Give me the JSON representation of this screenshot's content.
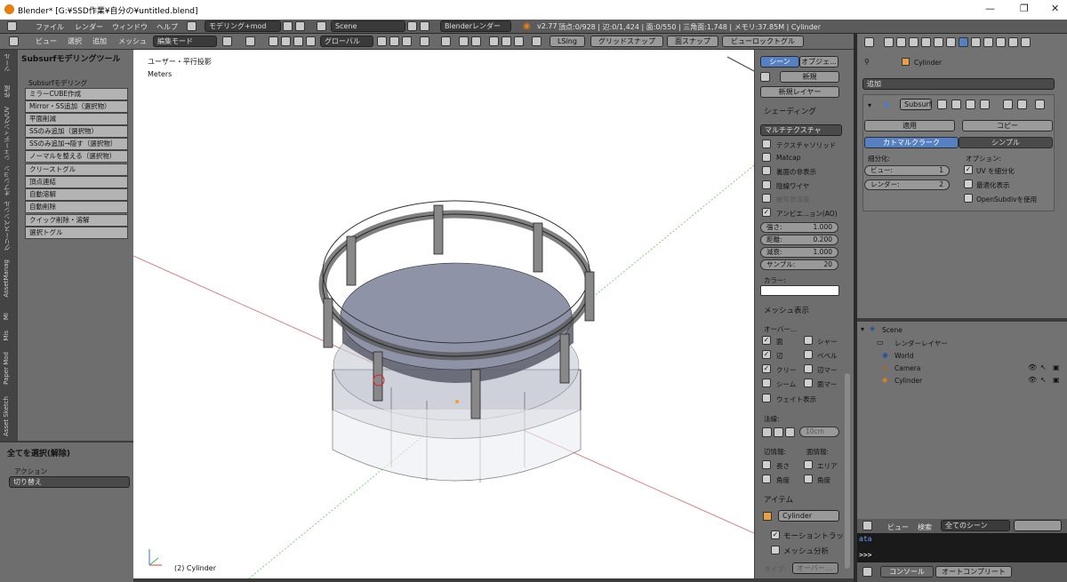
{
  "window": {
    "title": "Blender* [G:¥SSD作業¥自分の¥untitled.blend]",
    "controls": [
      "—",
      "❐",
      "✕"
    ]
  },
  "topbar": {
    "menus": [
      "ファイル",
      "レンダー",
      "ウィンドウ",
      "ヘルプ"
    ],
    "layout": "モデリング+mod",
    "scene": "Scene",
    "engine": "Blenderレンダー",
    "version": "v2.77",
    "stats": "頂点:0/928 | 辺:0/1,424 | 面:0/550 | 三角面:1,748 | メモリ:37.85M | Cylinder"
  },
  "viewheader": {
    "menus": [
      "ビュー",
      "選択",
      "追加",
      "メッシュ"
    ],
    "mode": "編集モード",
    "orientation": "グローバル",
    "lsing": "LSing",
    "grid_snap": "グリッドスナップ",
    "face_snap": "面スナップ",
    "viewlock": "ビューロックトグル"
  },
  "tabs": [
    "ツール",
    "作成",
    "シェーディング/UV",
    "オプション",
    "グリースペンシル",
    "AssetManag",
    "MI",
    "Mis",
    "Paper Mod",
    "Asset Sketch"
  ],
  "tool": {
    "panel_title": "Subsurfモデリングツール",
    "section": "Subsurfモデリング",
    "buttons": [
      "ミラーCUBE作成",
      "Mirror・SS追加（選択物）",
      "平面削減",
      "SSのみ追加（選択物）",
      "SSのみ追加→隠す（選択物）",
      "ノーマルを整える（選択物）",
      "クリーストグル",
      "頂点連結",
      "自動溶解",
      "自動削除",
      "クイック削除・溶解",
      "選択トグル"
    ],
    "op_title": "全てを選択(解除)",
    "action_label": "アクション",
    "action_value": "切り替え"
  },
  "viewport": {
    "view_name": "ユーザー・平行投影",
    "units": "Meters",
    "object_label": "(2) Cylinder"
  },
  "props": {
    "tab_scene": "シーン",
    "tab_object": "オブジェ...",
    "new": "新規",
    "new_layer": "新規レイヤー",
    "shading": "シェーディング",
    "shading_mode": "マルチテクスチャ",
    "shading_opts": [
      "テクスチャソリッド",
      "Matcap",
      "裏面の非表示",
      "陰線ワイヤ",
      "被写界深度",
      "アンビエ...ョン(AO)"
    ],
    "ao": [
      {
        "l": "強さ:",
        "v": "1.000"
      },
      {
        "l": "距離:",
        "v": "0.200"
      },
      {
        "l": "減衰:",
        "v": "1.000"
      },
      {
        "l": "サンプル:",
        "v": "20"
      }
    ],
    "color_label": "カラー:",
    "mesh_display": "メッシュ表示",
    "overlay": "オーバー...",
    "overlays": [
      [
        "面",
        "シャー"
      ],
      [
        "辺",
        "ベベル"
      ],
      [
        "クリー",
        "辺マー"
      ],
      [
        "シーム",
        "面マー"
      ]
    ],
    "weight": "ウェイト表示",
    "normals": "法線:",
    "normal_size": "10cm",
    "edge_info": "辺情報:",
    "face_info": "面情報:",
    "info": [
      [
        "長さ",
        "エリア"
      ],
      [
        "角度",
        "角度"
      ]
    ],
    "item": "アイテム",
    "item_name": "Cylinder",
    "motion": "モーショントラッ",
    "mesh_analysis": "メッシュ分析",
    "type_label": "タイプ:",
    "type_value": "オーバー..."
  },
  "right": {
    "breadcrumb": "Cylinder",
    "add": "追加",
    "mod_name": "Subsurf",
    "apply": "適用",
    "copy": "コピー",
    "catmull": "カトマルクラーク",
    "simple": "シンプル",
    "subdiv": "細分化:",
    "view": "ビュー:",
    "view_v": "1",
    "render": "レンダー:",
    "render_v": "2",
    "options": "オプション:",
    "uv": "UV を細分化",
    "opt": "最適化表示",
    "opensub": "OpenSubdivを使用"
  },
  "outliner": {
    "items": [
      "Scene",
      "レンダーレイヤー",
      "World",
      "Camera",
      "Cylinder"
    ],
    "view": "ビュー",
    "search": "検索",
    "filter": "全てのシーン"
  },
  "console": {
    "line1": "ata",
    "prompt": ">>> ",
    "console_btn": "コンソール",
    "autocomplete": "オートコンプリート"
  }
}
